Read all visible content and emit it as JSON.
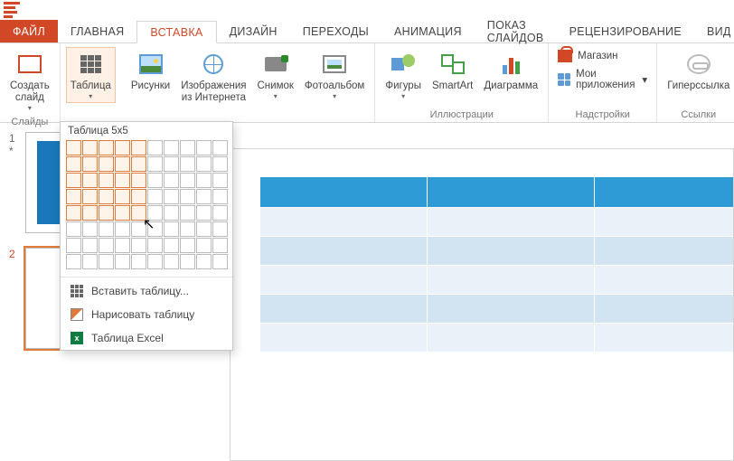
{
  "tabs": {
    "file": "ФАЙЛ",
    "home": "ГЛАВНАЯ",
    "insert": "ВСТАВКА",
    "design": "ДИЗАЙН",
    "transitions": "ПЕРЕХОДЫ",
    "animation": "АНИМАЦИЯ",
    "slideshow": "ПОКАЗ СЛАЙДОВ",
    "review": "РЕЦЕНЗИРОВАНИЕ",
    "view": "ВИД"
  },
  "ribbon": {
    "new_slide": "Создать\nслайд",
    "slides_group": "Слайды",
    "table": "Таблица",
    "pictures": "Рисунки",
    "online_pictures": "Изображения\nиз Интернета",
    "screenshot": "Снимок",
    "photo_album": "Фотоальбом",
    "shapes": "Фигуры",
    "smartart": "SmartArt",
    "chart": "Диаграмма",
    "illustrations_group": "Иллюстрации",
    "store": "Магазин",
    "my_apps": "Мои приложения",
    "addins_group": "Надстройки",
    "hyperlink": "Гиперссылка",
    "links_group": "Ссылки"
  },
  "dropdown": {
    "title": "Таблица 5x5",
    "rows": 5,
    "cols": 5,
    "insert_table": "Вставить таблицу...",
    "draw_table": "Нарисовать таблицу",
    "excel": "Таблица Excel"
  },
  "thumbs": {
    "n1": "1",
    "n2": "2",
    "star": "*"
  }
}
